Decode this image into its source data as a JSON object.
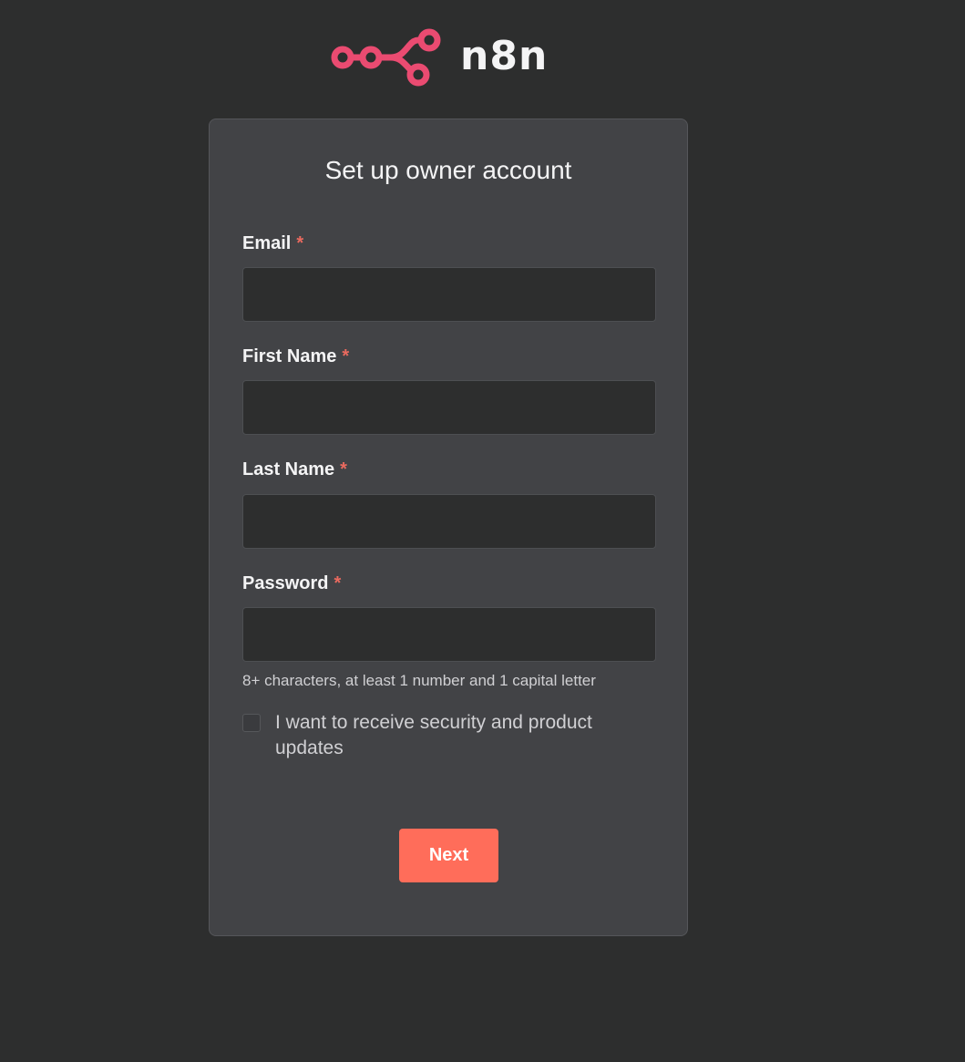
{
  "brand": {
    "name": "n8n",
    "logo_icon": "n8n-nodes-logo-icon",
    "logo_color": "#ea4b71"
  },
  "form": {
    "title": "Set up owner account",
    "required_marker": "*",
    "fields": [
      {
        "label": "Email",
        "value": "",
        "placeholder": ""
      },
      {
        "label": "First Name",
        "value": "",
        "placeholder": ""
      },
      {
        "label": "Last Name",
        "value": "",
        "placeholder": ""
      },
      {
        "label": "Password",
        "value": "",
        "placeholder": ""
      }
    ],
    "password_hint": "8+ characters, at least 1 number and 1 capital letter",
    "updates_checkbox": {
      "label": "I want to receive security and product updates",
      "checked": false
    },
    "next_label": "Next"
  },
  "colors": {
    "background": "#2d2e2e",
    "card": "#424346",
    "accent": "#ff6d5a",
    "required": "#ea6a5f"
  }
}
